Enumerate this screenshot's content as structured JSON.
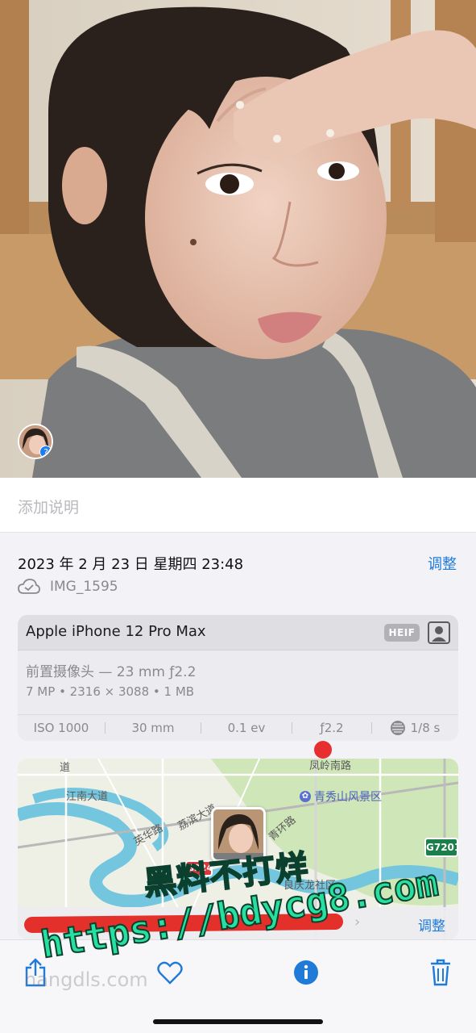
{
  "photo": {
    "people_badge": "?"
  },
  "caption": {
    "placeholder": "添加说明"
  },
  "info": {
    "datetime": "2023 年 2 月 23 日 星期四 23:48",
    "adjust_label": "调整",
    "filename": "IMG_1595",
    "camera": {
      "model": "Apple iPhone 12 Pro Max",
      "format_badge": "HEIF",
      "lens": "前置摄像头 — 23 mm ƒ2.2",
      "specs": "7 MP  •  2316 × 3088  •  1 MB",
      "exif": {
        "iso": "ISO 1000",
        "focal": "30 mm",
        "ev": "0.1 ev",
        "aperture": "ƒ2.2",
        "shutter": "1/8 s"
      }
    },
    "map": {
      "labels": {
        "road_top": "凤岭南路",
        "poi": "青秀山风景区",
        "jiangnan": "江南大道",
        "yingji": "英华路",
        "dadao": "荔滨大道",
        "qingxiu": "青环路",
        "shequ": "良庆龙社区",
        "road_left": "道"
      },
      "shield_right": "G7201",
      "shield_left": "G324",
      "adjust_label": "调整"
    }
  },
  "watermark": {
    "line1": "黑料不打烊",
    "line2": "https://bdycg8.com",
    "faint": "hangdls.com"
  },
  "colors": {
    "accent": "#1f7ad8",
    "watermark": "#27e0a0"
  }
}
